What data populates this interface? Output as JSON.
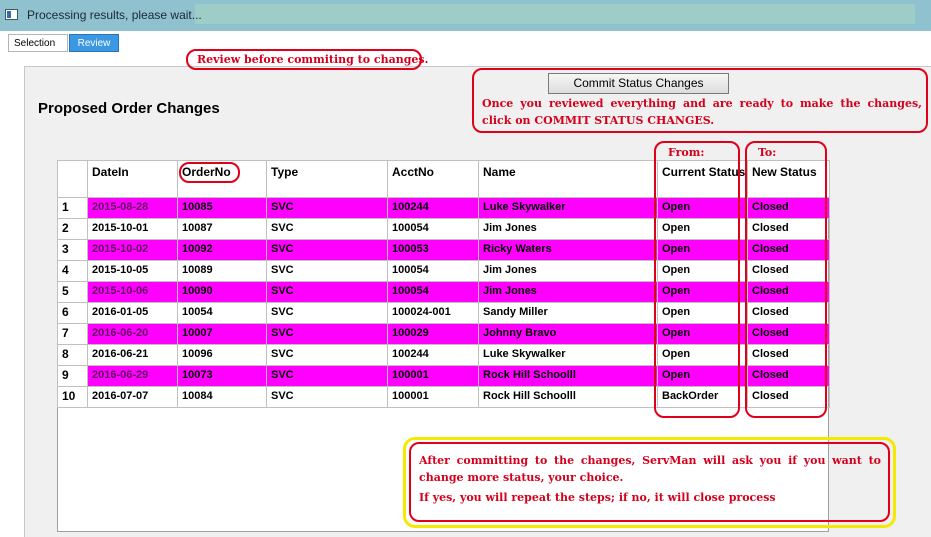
{
  "window": {
    "title": "Processing results, please wait..."
  },
  "tabs": [
    {
      "label": "Selection"
    },
    {
      "label": "Review"
    }
  ],
  "annotations": {
    "review_note": "Review before commiting to changes.",
    "commit_note": "Once you reviewed everything and are ready to make the changes, click on COMMIT STATUS CHANGES.",
    "from_label": "From:",
    "to_label": "To:",
    "after_note_line1": "After committing to the changes, ServMan will ask you if you want to change more status, your choice.",
    "after_note_line2": "If yes, you will repeat the steps; if no, it will close process"
  },
  "commit_button": {
    "label": "Commit Status Changes"
  },
  "page_heading": "Proposed Order Changes",
  "grid": {
    "columns": [
      "DateIn",
      "OrderNo",
      "Type",
      "AcctNo",
      "Name",
      "Current Status",
      "New Status"
    ],
    "highlight_color": "#ff00ff",
    "rows": [
      {
        "num": "1",
        "datein": "2015-08-28",
        "orderno": "10085",
        "type": "SVC",
        "acctno": "100244",
        "name": "Luke Skywalker",
        "current": "Open",
        "newstatus": "Closed",
        "highlight": true
      },
      {
        "num": "2",
        "datein": "2015-10-01",
        "orderno": "10087",
        "type": "SVC",
        "acctno": "100054",
        "name": "Jim Jones",
        "current": "Open",
        "newstatus": "Closed",
        "highlight": false
      },
      {
        "num": "3",
        "datein": "2015-10-02",
        "orderno": "10092",
        "type": "SVC",
        "acctno": "100053",
        "name": "Ricky Waters",
        "current": "Open",
        "newstatus": "Closed",
        "highlight": true
      },
      {
        "num": "4",
        "datein": "2015-10-05",
        "orderno": "10089",
        "type": "SVC",
        "acctno": "100054",
        "name": "Jim Jones",
        "current": "Open",
        "newstatus": "Closed",
        "highlight": false
      },
      {
        "num": "5",
        "datein": "2015-10-06",
        "orderno": "10090",
        "type": "SVC",
        "acctno": "100054",
        "name": "Jim Jones",
        "current": "Open",
        "newstatus": "Closed",
        "highlight": true
      },
      {
        "num": "6",
        "datein": "2016-01-05",
        "orderno": "10054",
        "type": "SVC",
        "acctno": "100024-001",
        "name": "Sandy Miller",
        "current": "Open",
        "newstatus": "Closed",
        "highlight": false
      },
      {
        "num": "7",
        "datein": "2016-06-20",
        "orderno": "10007",
        "type": "SVC",
        "acctno": "100029",
        "name": "Johnny Bravo",
        "current": "Open",
        "newstatus": "Closed",
        "highlight": true
      },
      {
        "num": "8",
        "datein": "2016-06-21",
        "orderno": "10096",
        "type": "SVC",
        "acctno": "100244",
        "name": "Luke Skywalker",
        "current": "Open",
        "newstatus": "Closed",
        "highlight": false
      },
      {
        "num": "9",
        "datein": "2016-06-29",
        "orderno": "10073",
        "type": "SVC",
        "acctno": "100001",
        "name": "Rock Hill Schoolll",
        "current": "Open",
        "newstatus": "Closed",
        "highlight": true
      },
      {
        "num": "10",
        "datein": "2016-07-07",
        "orderno": "10084",
        "type": "SVC",
        "acctno": "100001",
        "name": "Rock Hill Schoolll",
        "current": "BackOrder",
        "newstatus": "Closed",
        "highlight": false
      }
    ]
  }
}
